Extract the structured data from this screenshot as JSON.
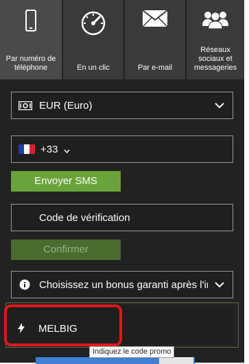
{
  "tabs": [
    {
      "label": "Par numéro de téléphone",
      "icon": "phone-icon",
      "active": true
    },
    {
      "label": "En un clic",
      "icon": "speedometer-icon",
      "active": false
    },
    {
      "label": "Par e-mail",
      "icon": "envelope-icon",
      "active": false
    },
    {
      "label": "Réseaux sociaux et messageries",
      "icon": "people-icon",
      "active": false
    }
  ],
  "currency": {
    "value": "EUR (Euro)",
    "icon": "banknote-icon"
  },
  "phone": {
    "dial_code": "+33",
    "flag": "flag-france-icon"
  },
  "send_sms_label": "Envoyer SMS",
  "verification": {
    "placeholder": "Code de vérification"
  },
  "confirm_label": "Confirmer",
  "bonus": {
    "text": "Choisissez un bonus garanti après l'ins",
    "icon": "info-icon"
  },
  "promo": {
    "value": "MELBIG",
    "icon": "lightning-icon",
    "tooltip": "Indiquez le code promo"
  },
  "colors": {
    "accent_green": "#6aa33a",
    "highlight_red": "#e01818",
    "panel_bg": "#222222"
  }
}
